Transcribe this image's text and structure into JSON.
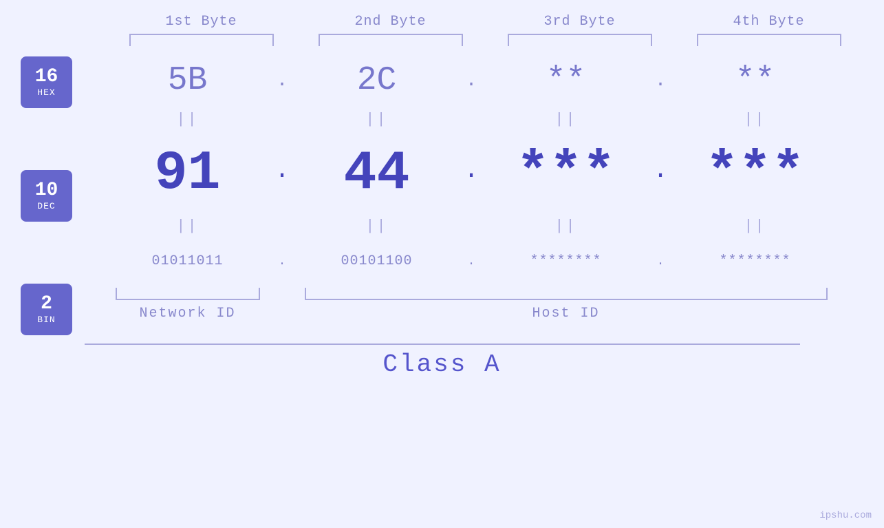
{
  "byteLabels": [
    "1st Byte",
    "2nd Byte",
    "3rd Byte",
    "4th Byte"
  ],
  "bases": [
    {
      "num": "16",
      "name": "HEX"
    },
    {
      "num": "10",
      "name": "DEC"
    },
    {
      "num": "2",
      "name": "BIN"
    }
  ],
  "hexValues": [
    "5B",
    "2C",
    "**",
    "**"
  ],
  "decValues": [
    "91",
    "44",
    "***",
    "***"
  ],
  "binValues": [
    "01011011",
    "00101100",
    "********",
    "********"
  ],
  "equalsSymbol": "||",
  "dotSymbol": ".",
  "networkId": "Network ID",
  "hostId": "Host ID",
  "classLabel": "Class A",
  "watermark": "ipshu.com"
}
